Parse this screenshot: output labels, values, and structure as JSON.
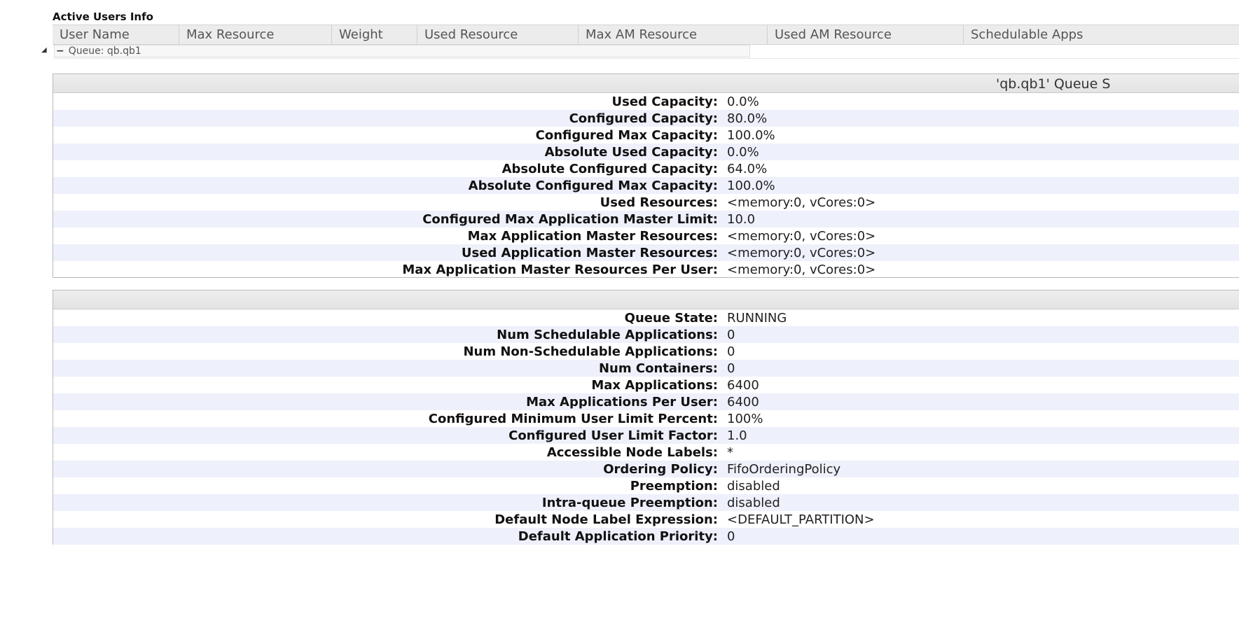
{
  "users_info": {
    "title": "Active Users Info",
    "columns": [
      {
        "label": "User Name"
      },
      {
        "label": "Max Resource"
      },
      {
        "label": "Weight"
      },
      {
        "label": "Used Resource"
      },
      {
        "label": "Max AM Resource"
      },
      {
        "label": "Used AM Resource"
      },
      {
        "label": "Schedulable Apps"
      }
    ]
  },
  "queue_toggle": {
    "symbol": "−",
    "label": "Queue: qb.qb1"
  },
  "capacity_panel": {
    "caption": "'qb.qb1' Queue S",
    "rows": [
      {
        "label": "Used Capacity:",
        "value": "0.0%"
      },
      {
        "label": "Configured Capacity:",
        "value": "80.0%"
      },
      {
        "label": "Configured Max Capacity:",
        "value": "100.0%"
      },
      {
        "label": "Absolute Used Capacity:",
        "value": "0.0%"
      },
      {
        "label": "Absolute Configured Capacity:",
        "value": "64.0%"
      },
      {
        "label": "Absolute Configured Max Capacity:",
        "value": "100.0%"
      },
      {
        "label": "Used Resources:",
        "value": "<memory:0, vCores:0>"
      },
      {
        "label": "Configured Max Application Master Limit:",
        "value": "10.0"
      },
      {
        "label": "Max Application Master Resources:",
        "value": "<memory:0, vCores:0>"
      },
      {
        "label": "Used Application Master Resources:",
        "value": "<memory:0, vCores:0>"
      },
      {
        "label": "Max Application Master Resources Per User:",
        "value": "<memory:0, vCores:0>"
      }
    ]
  },
  "state_panel": {
    "caption": "",
    "rows": [
      {
        "label": "Queue State:",
        "value": "RUNNING"
      },
      {
        "label": "Num Schedulable Applications:",
        "value": "0"
      },
      {
        "label": "Num Non-Schedulable Applications:",
        "value": "0"
      },
      {
        "label": "Num Containers:",
        "value": "0"
      },
      {
        "label": "Max Applications:",
        "value": "6400"
      },
      {
        "label": "Max Applications Per User:",
        "value": "6400"
      },
      {
        "label": "Configured Minimum User Limit Percent:",
        "value": "100%"
      },
      {
        "label": "Configured User Limit Factor:",
        "value": "1.0"
      },
      {
        "label": "Accessible Node Labels:",
        "value": "*"
      },
      {
        "label": "Ordering Policy:",
        "value": "FifoOrderingPolicy"
      },
      {
        "label": "Preemption:",
        "value": "disabled"
      },
      {
        "label": "Intra-queue Preemption:",
        "value": "disabled"
      },
      {
        "label": "Default Node Label Expression:",
        "value": "<DEFAULT_PARTITION>"
      },
      {
        "label": "Default Application Priority:",
        "value": "0"
      }
    ]
  }
}
